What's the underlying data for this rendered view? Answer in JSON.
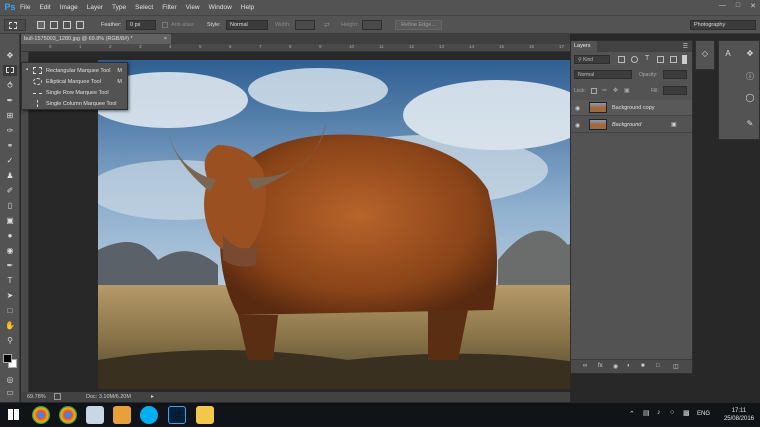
{
  "menu": {
    "logo": "Ps",
    "items": [
      "File",
      "Edit",
      "Image",
      "Layer",
      "Type",
      "Select",
      "Filter",
      "View",
      "Window",
      "Help"
    ]
  },
  "options": {
    "feather_label": "Feather:",
    "feather_value": "0 px",
    "antialias_label": "Anti-alias",
    "style_label": "Style:",
    "style_value": "Normal",
    "width_label": "Width:",
    "height_label": "Height:",
    "refine_edge": "Refine Edge..."
  },
  "workspace": "Photography",
  "document": {
    "tab_title": "bull-1575003_1280.jpg @ 69.8% (RGB/8#) *",
    "close": "×",
    "ruler_ticks": [
      "0",
      "1",
      "2",
      "3",
      "4",
      "5",
      "6",
      "7",
      "8",
      "9",
      "10",
      "11",
      "12",
      "13",
      "14",
      "15",
      "16",
      "17"
    ]
  },
  "status": {
    "zoom": "69.78%",
    "doc": "Doc: 3.10M/6.20M"
  },
  "flyout": {
    "items": [
      {
        "label": "Rectangular Marquee Tool",
        "key": "M",
        "selected": true
      },
      {
        "label": "Elliptical Marquee Tool",
        "key": "M",
        "selected": false
      },
      {
        "label": "Single Row Marquee Tool",
        "key": "",
        "selected": false
      },
      {
        "label": "Single Column Marquee Tool",
        "key": "",
        "selected": false
      }
    ]
  },
  "layers": {
    "title": "Layers",
    "kind": "Kind",
    "blend": "Normal",
    "opacity_label": "Opacity:",
    "lock_label": "Lock:",
    "fill_label": "Fill:",
    "rows": [
      {
        "name": "Background copy"
      },
      {
        "name": "Background"
      }
    ]
  },
  "taskbar": {
    "lang": "ENG",
    "time": "17:11",
    "date": "25/08/2016"
  }
}
